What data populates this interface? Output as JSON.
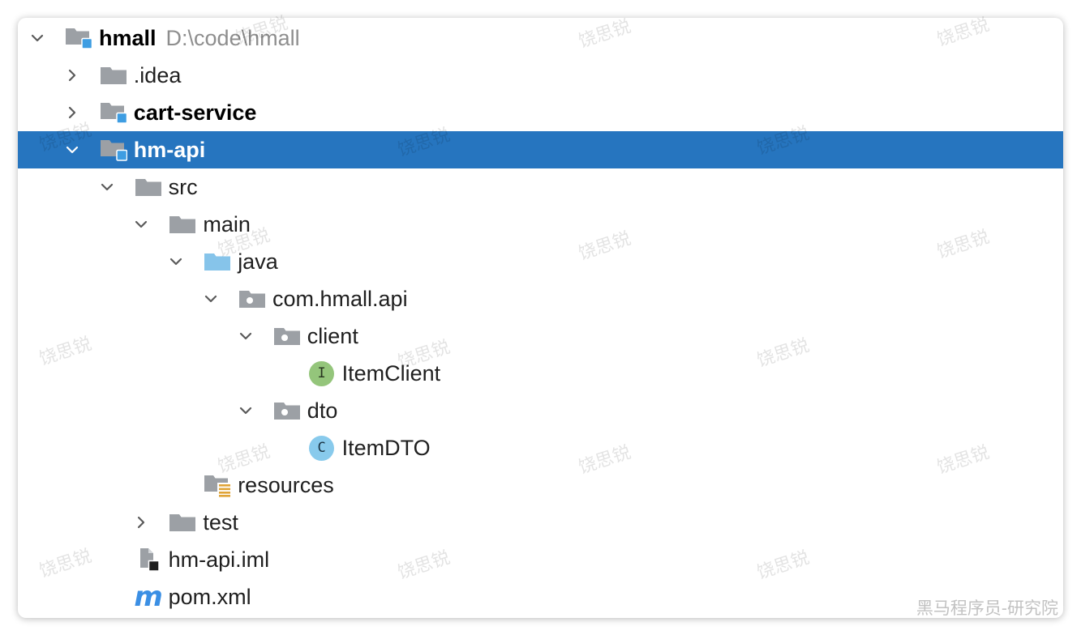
{
  "project_tree": {
    "root": {
      "label": "hmall",
      "path": "D:\\code\\hmall",
      "icon": "module-folder-icon",
      "expanded": true,
      "children": [
        {
          "label": ".idea",
          "icon": "folder-icon",
          "expanded": false
        },
        {
          "label": "cart-service",
          "icon": "module-folder-icon",
          "expanded": false
        },
        {
          "label": "hm-api",
          "icon": "module-folder-icon",
          "expanded": true,
          "selected": true,
          "children": [
            {
              "label": "src",
              "icon": "folder-icon",
              "expanded": true,
              "children": [
                {
                  "label": "main",
                  "icon": "folder-icon",
                  "expanded": true,
                  "children": [
                    {
                      "label": "java",
                      "icon": "source-root-folder-icon",
                      "expanded": true,
                      "children": [
                        {
                          "label": "com.hmall.api",
                          "icon": "package-icon",
                          "expanded": true,
                          "children": [
                            {
                              "label": "client",
                              "icon": "package-icon",
                              "expanded": true,
                              "children": [
                                {
                                  "label": "ItemClient",
                                  "icon": "interface-icon",
                                  "icon_letter": "I"
                                }
                              ]
                            },
                            {
                              "label": "dto",
                              "icon": "package-icon",
                              "expanded": true,
                              "children": [
                                {
                                  "label": "ItemDTO",
                                  "icon": "class-icon",
                                  "icon_letter": "C"
                                }
                              ]
                            }
                          ]
                        }
                      ]
                    },
                    {
                      "label": "resources",
                      "icon": "resources-root-folder-icon"
                    }
                  ]
                },
                {
                  "label": "test",
                  "icon": "folder-icon",
                  "expanded": false
                }
              ]
            },
            {
              "label": "hm-api.iml",
              "icon": "module-file-icon"
            },
            {
              "label": "pom.xml",
              "icon": "maven-icon",
              "icon_letter": "m"
            }
          ]
        }
      ]
    }
  },
  "watermark": "饶思锐",
  "corner_watermark": "黑马程序员-研究院",
  "colors": {
    "selection": "#2675bf",
    "text": "#1f1f1f",
    "path_text": "#8e8e8e",
    "folder": "#9ca0a5",
    "source_root_folder": "#86c4ea",
    "module_badge": "#3e9de2",
    "resources_lines": "#e0a437",
    "interface_badge": "#94c57b",
    "class_badge": "#88caec",
    "maven": "#3b8fe4"
  }
}
